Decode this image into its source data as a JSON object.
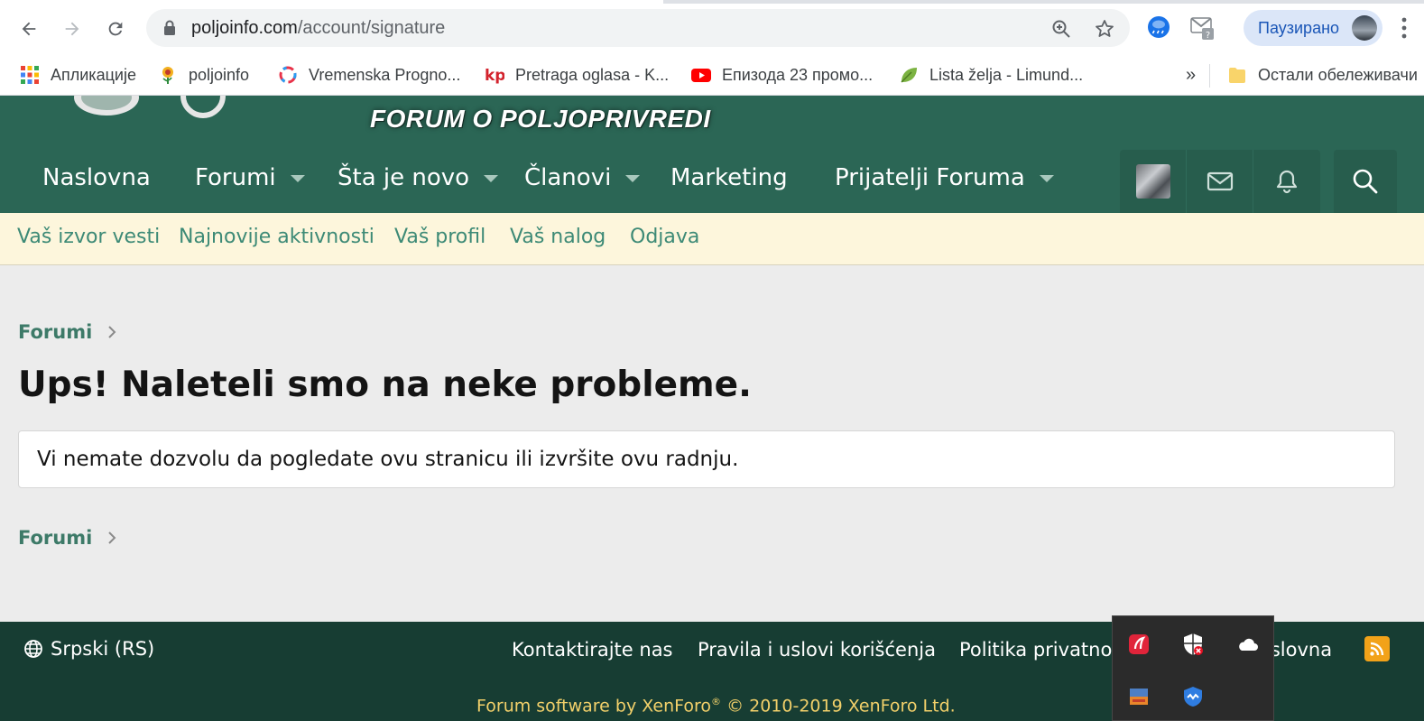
{
  "browser": {
    "url_host": "poljoinfo.com",
    "url_path": "/account/signature",
    "profile_label": "Паузирано",
    "bookmarks": [
      {
        "label": "Апликације",
        "icon": "apps-grid-icon"
      },
      {
        "label": "poljoinfo",
        "icon": "flower-icon"
      },
      {
        "label": "Vremenska Progno...",
        "icon": "ring-icon"
      },
      {
        "label": "Pretraga oglasa - K...",
        "icon": "kp-icon"
      },
      {
        "label": "Епизода 23 промо...",
        "icon": "youtube-icon"
      },
      {
        "label": "Lista želja - Limund...",
        "icon": "leaf-icon"
      }
    ],
    "bookmarks_overflow": "»",
    "other_bookmarks": "Остали обележивачи",
    "kp_text": "kp"
  },
  "site": {
    "tagline": "FORUM O POLJOPRIVREDI",
    "nav": [
      {
        "label": "Naslovna",
        "has_menu": false
      },
      {
        "label": "Forumi",
        "has_menu": true
      },
      {
        "label": "Šta je novo",
        "has_menu": true
      },
      {
        "label": "Članovi",
        "has_menu": true
      },
      {
        "label": "Marketing",
        "has_menu": false
      },
      {
        "label": "Prijatelji Foruma",
        "has_menu": true
      }
    ],
    "subnav": [
      "Vaš izvor vesti",
      "Najnovije aktivnosti",
      "Vaš profil",
      "Vaš nalog",
      "Odjava"
    ]
  },
  "content": {
    "breadcrumb": "Forumi",
    "title": "Ups! Naleteli smo na neke probleme.",
    "message": "Vi nemate dozvolu da pogledate ovu stranicu ili izvršite ovu radnju."
  },
  "footer": {
    "language": "Srpski (RS)",
    "links": [
      "Kontaktirajte nas",
      "Pravila i uslovi korišćenja",
      "Politika privatno",
      "aslovna"
    ],
    "copyright_prefix": "Forum software by XenForo",
    "copyright_mark": "®",
    "copyright_suffix": " © 2010-2019 XenForo Ltd."
  },
  "colors": {
    "header_green": "#2b6655",
    "subnav_bg": "#fdf6dc",
    "link_green": "#3d8a76",
    "footer_bg": "#173d33",
    "copyright": "#f2d06a"
  }
}
